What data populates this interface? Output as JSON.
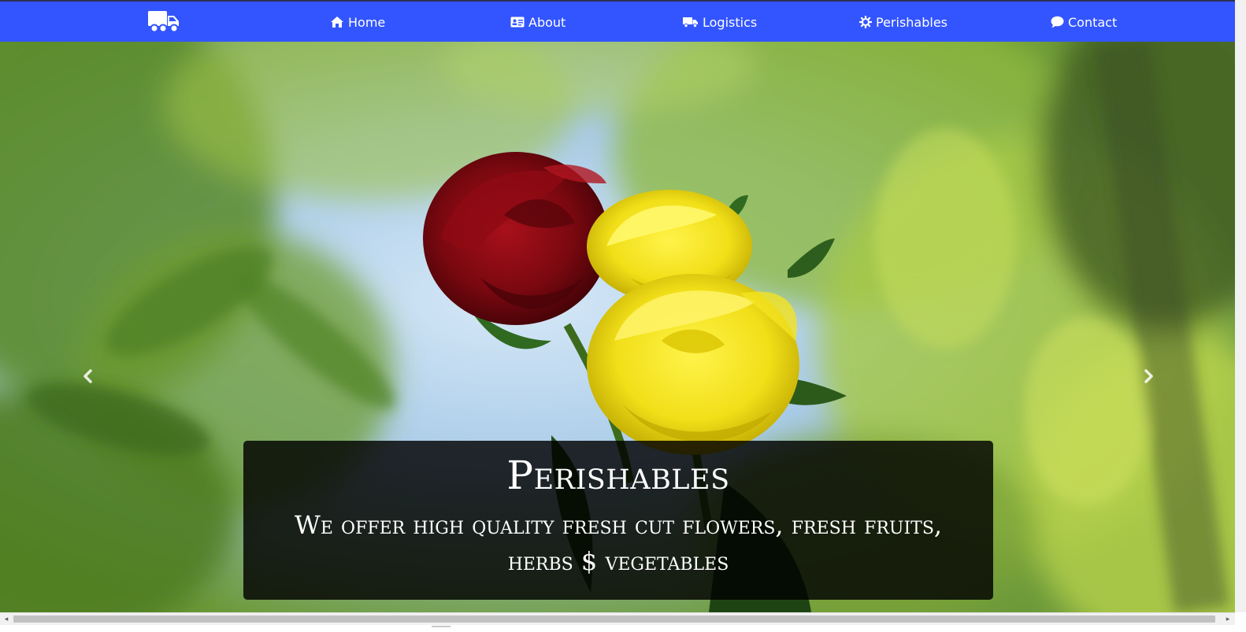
{
  "navbar": {
    "brand_icon": "truck-icon",
    "background": "#3355ff",
    "items": [
      {
        "label": "Home",
        "icon": "home-icon"
      },
      {
        "label": "About",
        "icon": "id-card-icon"
      },
      {
        "label": "Logistics",
        "icon": "truck-icon"
      },
      {
        "label": "Perishables",
        "icon": "gear-icon"
      },
      {
        "label": "Contact",
        "icon": "comment-icon"
      }
    ]
  },
  "hero": {
    "image": "rose-bouquet-photo",
    "caption": {
      "title": "Perishables",
      "text": "We offer high quality fresh cut flowers, fresh fruits, herbs $ vegetables"
    },
    "controls": {
      "prev_icon": "chevron-left-icon",
      "next_icon": "chevron-right-icon"
    }
  },
  "scrollbar": {
    "left_arrow": "◂",
    "right_arrow": "▸"
  }
}
